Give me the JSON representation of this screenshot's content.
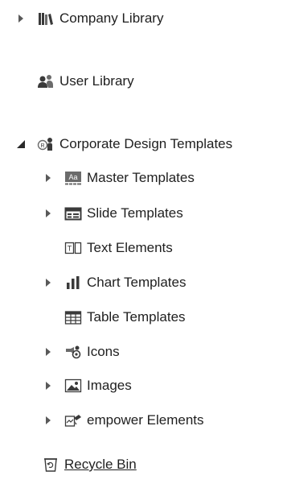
{
  "tree": {
    "company_library": {
      "label": "Company Library",
      "icon": "books-icon",
      "expanded": false
    },
    "user_library": {
      "label": "User Library",
      "icon": "users-icon"
    },
    "corporate_templates": {
      "label": "Corporate Design Templates",
      "icon": "corporate-templates-icon",
      "expanded": true,
      "children": [
        {
          "label": "Master Templates",
          "icon": "master-template-icon",
          "expandable": true
        },
        {
          "label": "Slide Templates",
          "icon": "slide-template-icon",
          "expandable": true
        },
        {
          "label": "Text Elements",
          "icon": "text-element-icon",
          "expandable": false
        },
        {
          "label": "Chart Templates",
          "icon": "bar-chart-icon",
          "expandable": true
        },
        {
          "label": "Table Templates",
          "icon": "table-icon",
          "expandable": false
        },
        {
          "label": "Icons",
          "icon": "icons-icon",
          "expandable": true
        },
        {
          "label": "Images",
          "icon": "image-icon",
          "expandable": true
        },
        {
          "label": "empower Elements",
          "icon": "empower-elements-icon",
          "expandable": true
        }
      ]
    },
    "recycle_bin": {
      "label": "Recycle Bin",
      "icon": "recycle-bin-icon"
    }
  },
  "colors": {
    "text": "#1f1f1f",
    "caret": "#595959",
    "icon_dark": "#3a3a3a",
    "icon_mid": "#6b6b6b"
  }
}
